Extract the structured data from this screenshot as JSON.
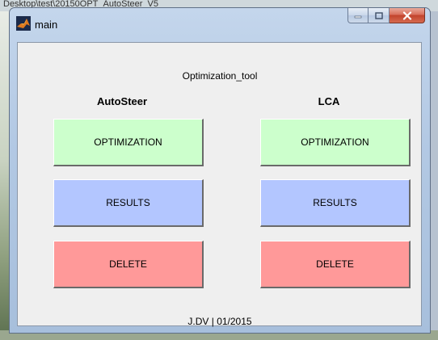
{
  "background": {
    "path_fragment": "Desktop\\test\\20150OPT_AutoSteer_V5"
  },
  "window": {
    "title": "main",
    "icon": "matlab-icon",
    "controls": {
      "minimize": "minimize-icon",
      "maximize": "maximize-icon",
      "close": "close-icon"
    }
  },
  "panel": {
    "title": "Optimization_tool",
    "left_header": "AutoSteer",
    "right_header": "LCA",
    "footer": "J.DV | 01/2015"
  },
  "left_buttons": {
    "optimization": "OPTIMIZATION",
    "results": "RESULTS",
    "delete": "DELETE"
  },
  "right_buttons": {
    "optimization": "OPTIMIZATION",
    "results": "RESULTS",
    "delete": "DELETE"
  },
  "colors": {
    "optimization": "#ccffcc",
    "results": "#b3c6ff",
    "delete": "#ff9999"
  }
}
